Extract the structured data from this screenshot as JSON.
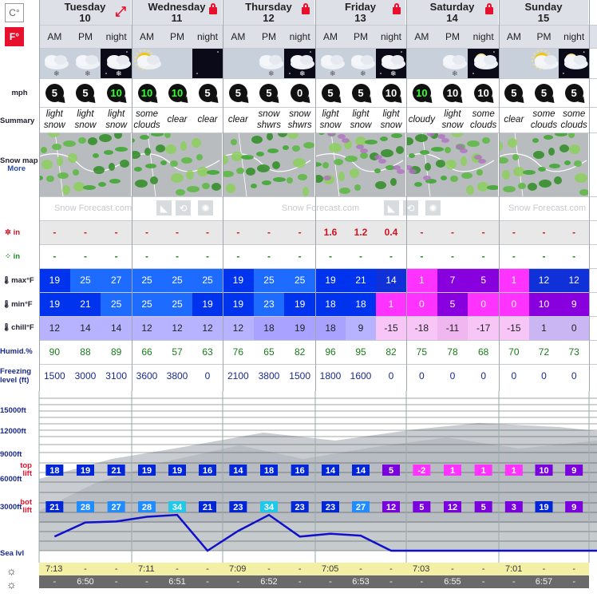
{
  "units": {
    "celsius": "C°",
    "fahrenheit": "F°"
  },
  "days": [
    {
      "name": "Tuesday",
      "date": "10",
      "icon": "expand-arrows-icon"
    },
    {
      "name": "Wednesday",
      "date": "11",
      "icon": "lock-icon"
    },
    {
      "name": "Thursday",
      "date": "12",
      "icon": "lock-icon"
    },
    {
      "name": "Friday",
      "date": "13",
      "icon": "lock-icon"
    },
    {
      "name": "Saturday",
      "date": "14",
      "icon": "lock-icon"
    },
    {
      "name": "Sunday",
      "date": "15",
      "icon": ""
    }
  ],
  "periods": [
    "AM",
    "PM",
    "night",
    "AM",
    "PM",
    "night",
    "AM",
    "PM",
    "night",
    "AM",
    "PM",
    "night",
    "AM",
    "PM",
    "night",
    "AM",
    "PM",
    "night"
  ],
  "row_labels": {
    "wind": "mph",
    "summary": "Summary",
    "snowmap": "Snow map",
    "more": "More",
    "snow": "in",
    "rain": "in",
    "max": "max°F",
    "min": "min°F",
    "chill": "chill°F",
    "humid": "Humid.%",
    "freezing1": "Freezing",
    "freezing2": "level (ft)",
    "lvl15000": "15000ft",
    "lvl12000": "12000ft",
    "lvl9000": "9000ft",
    "lvl6000": "6000ft",
    "lvl3000": "3000ft",
    "sealvl": "Sea lvl",
    "top1": "top",
    "top2": "lift",
    "bot1": "bot",
    "bot2": "lift"
  },
  "wind": [
    "5",
    "5",
    "10",
    "10",
    "10",
    "5",
    "5",
    "5",
    "0",
    "5",
    "5",
    "10",
    "10",
    "10",
    "10",
    "5",
    "5",
    "5"
  ],
  "wind_green": [
    false,
    false,
    true,
    true,
    true,
    false,
    false,
    false,
    false,
    false,
    false,
    false,
    true,
    false,
    false,
    false,
    false,
    false
  ],
  "summary": [
    [
      "light",
      "snow"
    ],
    [
      "light",
      "snow"
    ],
    [
      "light",
      "snow"
    ],
    [
      "some",
      "clouds"
    ],
    [
      "clear",
      ""
    ],
    [
      "clear",
      ""
    ],
    [
      "clear",
      ""
    ],
    [
      "snow",
      "shwrs"
    ],
    [
      "snow",
      "shwrs"
    ],
    [
      "light",
      "snow"
    ],
    [
      "light",
      "snow"
    ],
    [
      "light",
      "snow"
    ],
    [
      "cloudy",
      ""
    ],
    [
      "light",
      "snow"
    ],
    [
      "some",
      "clouds"
    ],
    [
      "clear",
      ""
    ],
    [
      "some",
      "clouds"
    ],
    [
      "some",
      "clouds"
    ]
  ],
  "watermark": "Snow Forecast.com",
  "snow_in": [
    "-",
    "-",
    "-",
    "-",
    "-",
    "-",
    "-",
    "-",
    "-",
    "1.6",
    "1.2",
    "0.4",
    "-",
    "-",
    "-",
    "-",
    "-",
    "-"
  ],
  "rain_in": [
    "-",
    "-",
    "-",
    "-",
    "-",
    "-",
    "-",
    "-",
    "-",
    "-",
    "-",
    "-",
    "-",
    "-",
    "-",
    "-",
    "-",
    "-"
  ],
  "max_f": [
    "19",
    "25",
    "27",
    "25",
    "25",
    "25",
    "19",
    "25",
    "25",
    "19",
    "21",
    "14",
    "1",
    "7",
    "5",
    "1",
    "12",
    "12"
  ],
  "min_f": [
    "19",
    "21",
    "25",
    "25",
    "25",
    "19",
    "19",
    "23",
    "19",
    "18",
    "18",
    "1",
    "0",
    "5",
    "0",
    "0",
    "10",
    "9"
  ],
  "chill_f": [
    "12",
    "14",
    "14",
    "12",
    "12",
    "12",
    "12",
    "18",
    "19",
    "18",
    "9",
    "-15",
    "-18",
    "-11",
    "-17",
    "-15",
    "1",
    "0"
  ],
  "humid": [
    "90",
    "88",
    "89",
    "66",
    "57",
    "63",
    "76",
    "65",
    "82",
    "96",
    "95",
    "82",
    "75",
    "78",
    "68",
    "70",
    "72",
    "73"
  ],
  "freezing_ft": [
    1500,
    3000,
    3100,
    3600,
    3800,
    0,
    2100,
    3800,
    1500,
    1800,
    1600,
    0,
    0,
    0,
    0,
    0,
    0,
    0
  ],
  "top_lift": [
    "18",
    "19",
    "21",
    "19",
    "19",
    "16",
    "14",
    "18",
    "16",
    "14",
    "14",
    "5",
    "-2",
    "1",
    "1",
    "1",
    "10",
    "9"
  ],
  "bot_lift": [
    "21",
    "28",
    "27",
    "28",
    "34",
    "21",
    "23",
    "34",
    "23",
    "23",
    "27",
    "12",
    "5",
    "12",
    "5",
    "3",
    "19",
    "9"
  ],
  "sunrise": [
    "7:13",
    "-",
    "-",
    "7:11",
    "-",
    "-",
    "7:09",
    "-",
    "-",
    "7:05",
    "-",
    "-",
    "7:03",
    "-",
    "-",
    "7:01",
    "-",
    "-"
  ],
  "sunset": [
    "-",
    "6:50",
    "-",
    "-",
    "6:51",
    "-",
    "-",
    "6:52",
    "-",
    "-",
    "6:53",
    "-",
    "-",
    "6:55",
    "-",
    "-",
    "6:57",
    "-"
  ],
  "colors": {
    "red": "#e8112d",
    "blue": "#0000e0",
    "purple": "#8800dd",
    "pink": "#ff33ff",
    "line": "#1010cc"
  }
}
